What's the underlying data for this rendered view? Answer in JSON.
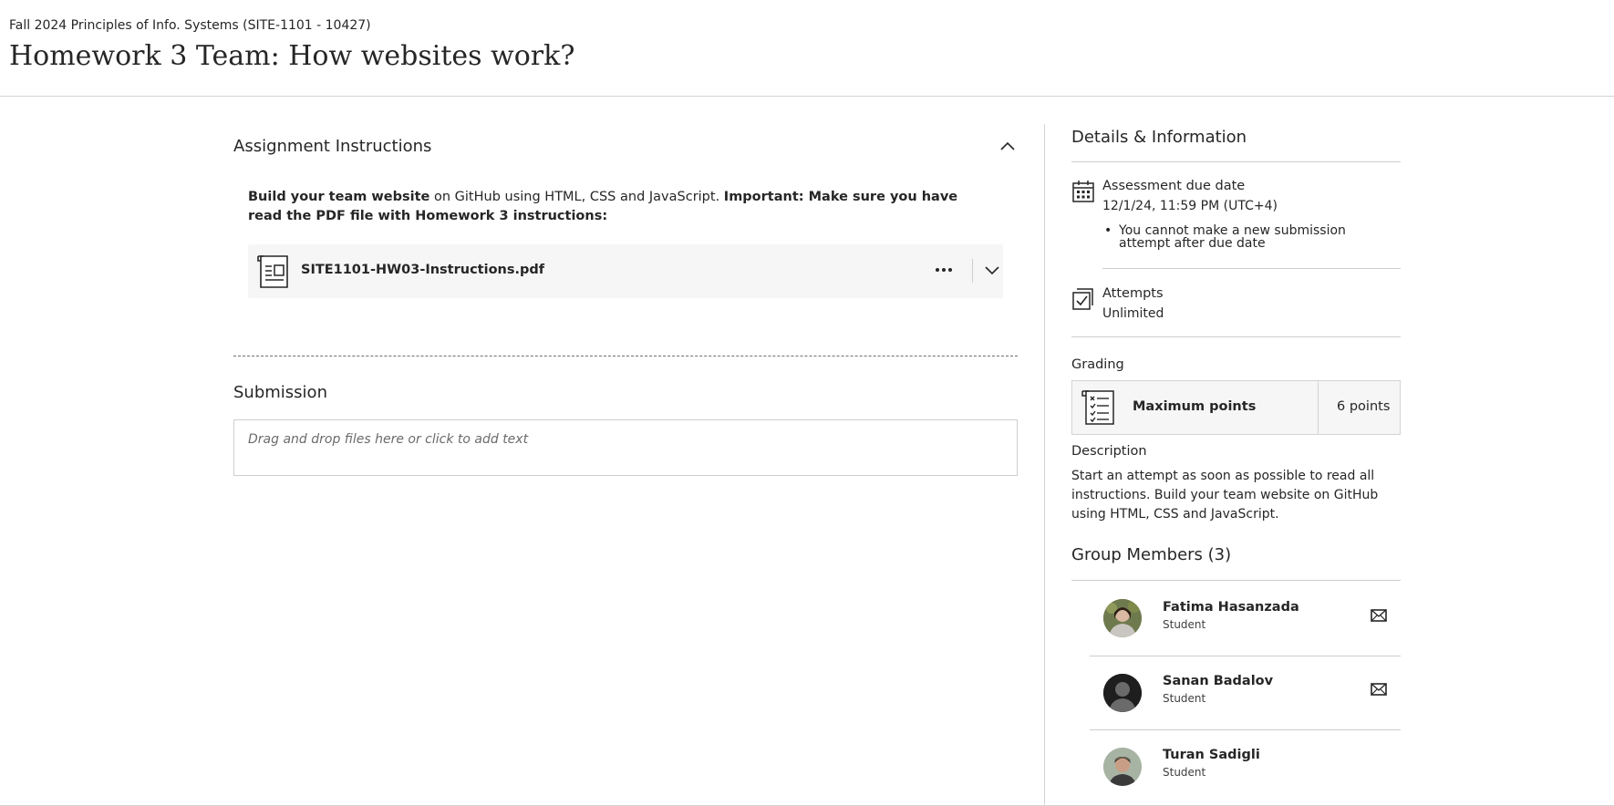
{
  "header": {
    "breadcrumb": "Fall 2024 Principles of Info. Systems (SITE-1101 - 10427)",
    "title": "Homework 3 Team: How websites work?"
  },
  "instructions": {
    "section_title": "Assignment Instructions",
    "text_bold_1": "Build your team website",
    "text_normal": " on GitHub using HTML, CSS and JavaScript. ",
    "text_bold_2": "Important: Make sure you have read the PDF file with Homework 3 instructions:",
    "file_name": "SITE1101-HW03-Instructions.pdf"
  },
  "submission": {
    "title": "Submission",
    "placeholder": "Drag and drop files here or click to add text"
  },
  "details": {
    "title": "Details & Information",
    "due_label": "Assessment due date",
    "due_value": "12/1/24, 11:59 PM (UTC+4)",
    "due_note": "You cannot make a new submission attempt after due date",
    "attempts_label": "Attempts",
    "attempts_value": "Unlimited",
    "grading_label": "Grading",
    "max_points_label": "Maximum points",
    "max_points_value": "6 points",
    "description_label": "Description",
    "description_text": "Start an attempt as soon as possible to read all instructions. Build your team website on GitHub using HTML, CSS and JavaScript."
  },
  "members": {
    "title": "Group Members (3)",
    "list": [
      {
        "name": "Fatima Hasanzada",
        "role": "Student",
        "has_message": true
      },
      {
        "name": "Sanan Badalov",
        "role": "Student",
        "has_message": true
      },
      {
        "name": "Turan Sadigli",
        "role": "Student",
        "has_message": false
      }
    ]
  },
  "icons": {
    "collapse": "chevron-up-icon",
    "file": "document-icon",
    "more": "more-horizontal-icon",
    "expand": "chevron-down-icon",
    "due": "calendar-icon",
    "attempts": "attempts-icon",
    "grading": "rubric-icon",
    "message": "envelope-icon"
  }
}
